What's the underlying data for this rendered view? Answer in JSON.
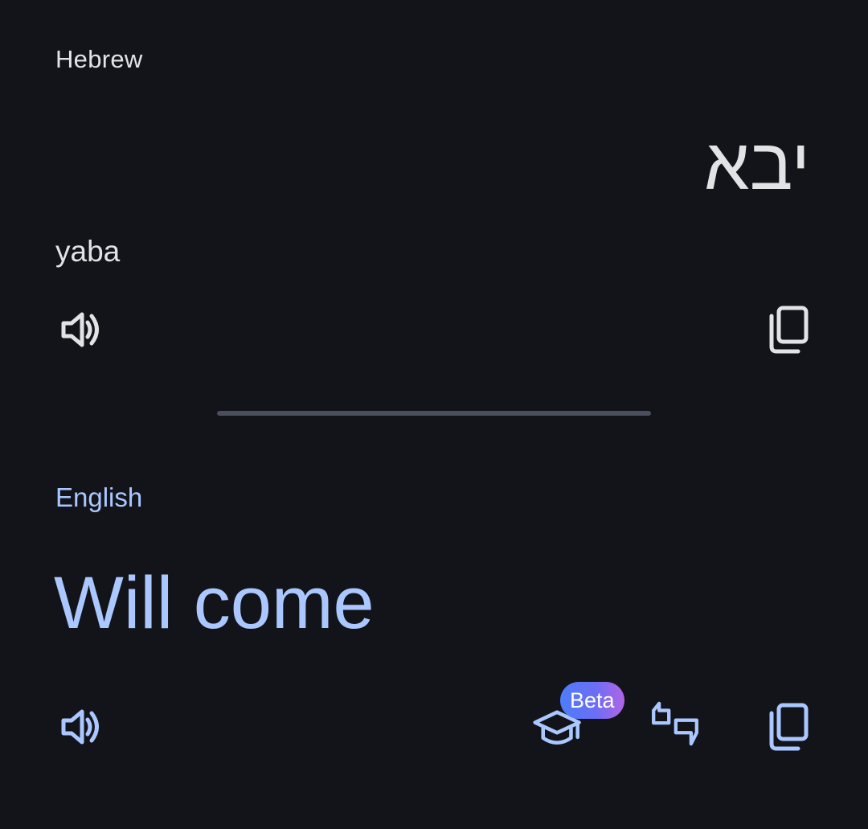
{
  "source": {
    "language": "Hebrew",
    "text": "יבא",
    "transliteration": "yaba"
  },
  "target": {
    "language": "English",
    "text": "Will come"
  },
  "badges": {
    "beta": "Beta"
  },
  "icons": {
    "source_listen": "volume-icon",
    "source_copy": "copy-icon",
    "target_listen": "volume-icon",
    "target_learn": "school-cap-icon",
    "target_alternatives": "quote-icon",
    "target_copy": "copy-icon"
  },
  "colors": {
    "background": "#131419",
    "source_text": "#e3e3e6",
    "target_text": "#aac7ff",
    "divider": "#4a4f5e"
  }
}
